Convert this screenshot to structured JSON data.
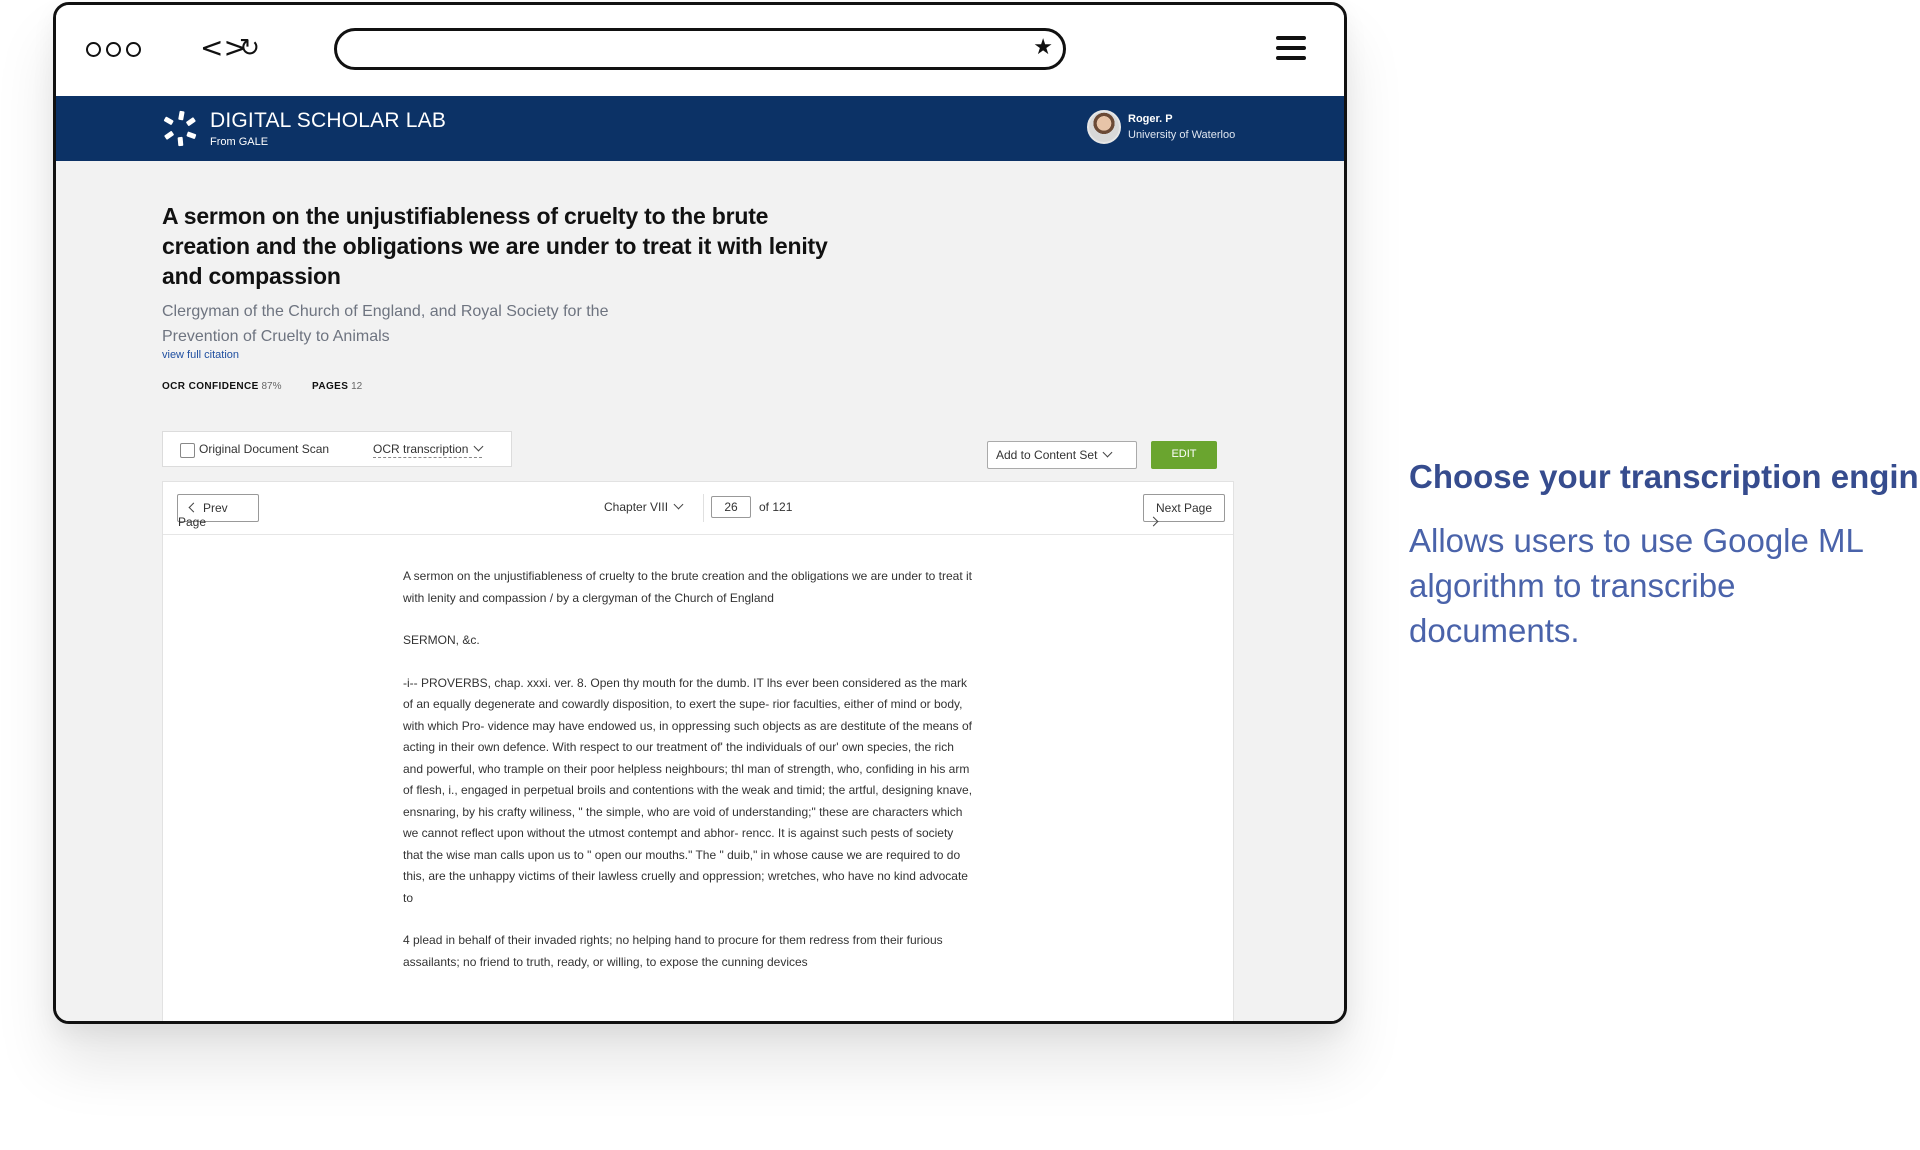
{
  "app": {
    "brand_title": "DIGITAL SCHOLAR LAB",
    "brand_subtitle": "From GALE",
    "user_name": "Roger. P",
    "user_org": "University of Waterloo"
  },
  "browser": {
    "url": ""
  },
  "document": {
    "title": "A sermon on the unjustifiableness of cruelty to the brute creation and the obligations we are under to treat it with lenity and compassion",
    "author": "Clergyman of the Church of England, and Royal Society for the Prevention of Cruelty to Animals",
    "citation_link": "view full citation",
    "ocr_confidence_label": "OCR CONFIDENCE",
    "ocr_confidence_value": "87%",
    "pages_label": "PAGES",
    "pages_value": "12"
  },
  "view_toggle": {
    "original_scan_label": "Original Document Scan",
    "original_scan_checked": false,
    "transcription_engine": "OCR transcription"
  },
  "actions": {
    "add_to_content_set": "Add to Content Set",
    "edit": "EDIT"
  },
  "reader": {
    "prev_page": "Prev Page",
    "next_page": "Next Page",
    "chapter": "Chapter VIII",
    "current_page": "26",
    "page_total": "of 121",
    "paragraphs": [
      "A sermon on the unjustifiableness of cruelty to the brute creation and the obligations we are under to treat it with lenity and compassion / by a clergyman of the Church of England",
      "SERMON, &c.",
      "-i-- PROVERBS, chap. xxxi. ver. 8. Open thy mouth for the dumb. IT lhs ever been considered as the mark of an equally degenerate and cowardly disposition, to exert the supe- rior faculties, either of mind or body, with which Pro- vidence may have endowed us, in oppressing such objects as are destitute of the means of acting in their own defence. With respect to our treatment of' the individuals of our' own species, the rich and powerful, who trample on their poor helpless neighbours; thl man of strength, who, confiding in his arm of flesh, i., engaged in perpetual broils and contentions with the weak and timid; the artful, designing knave, ensnaring, by his crafty wiliness, \" the simple, who are void of understanding;\" these are characters which we cannot reflect upon without the utmost contempt and abhor- rencc. It is against such pests of society that the wise man calls upon us to \" open our mouths.\" The \" duib,\" in whose cause we are required to do this, are the unhappy victims of their lawless cruelly and oppression; wretches, who have no kind advocate to",
      "4 plead in behalf of their invaded rights; no helping hand to procure for them redress from their furious assailants; no friend to truth, ready, or willing, to expose the cunning devices"
    ]
  },
  "caption": {
    "title": "Choose your transcription engine",
    "description": "Allows users to use Google ML algorithm to transcribe documents."
  },
  "icons": {
    "window_controls": "three-dots-icon",
    "code_nav": "code-brackets-icon",
    "reload": "reload-icon",
    "bookmark": "star-icon",
    "menu": "hamburger-icon",
    "brand": "gale-logo-icon"
  },
  "colors": {
    "header_bg": "#0c3266",
    "edit_button": "#6aa52f",
    "caption_title": "#364c8e",
    "caption_text": "#4a63aa",
    "link": "#1f4fa0"
  }
}
